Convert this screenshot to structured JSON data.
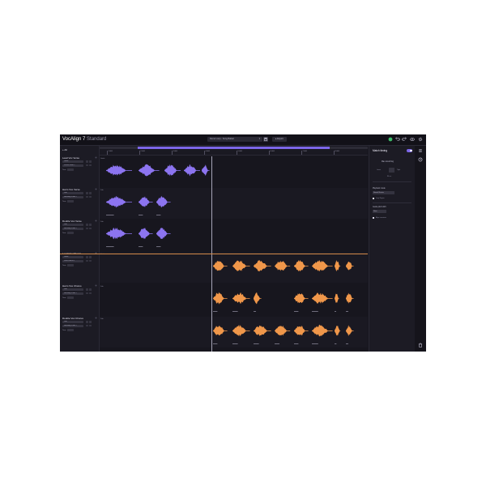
{
  "app": {
    "name": "VocAlign 7",
    "edition": "Standard"
  },
  "titlebar": {
    "session_name": "Demo Loop - Song Ballad",
    "export_label": "▸ Export"
  },
  "tracks_header": {
    "add_label": "+ All"
  },
  "tracks": [
    {
      "name": "Lead Vox Verse",
      "role": "Guide",
      "preset": "Vocals Guide 1",
      "time_label": "Time",
      "color": "#8c74f0"
    },
    {
      "name": "Harm Vox Verse",
      "role": "Dub",
      "preset": "Harmony Guide 1",
      "time_label": "Time",
      "color": "#8c74f0"
    },
    {
      "name": "Double Vox Verse",
      "role": "Dub",
      "preset": "Harmony Guide 1",
      "time_label": "Time",
      "color": "#8c74f0"
    },
    {
      "name": "Lead Vox Chorus",
      "role": "Guide",
      "preset": "Lead Chorus 1",
      "time_label": "Time",
      "color": "#f0974a"
    },
    {
      "name": "Harm Vox Chorus",
      "role": "Dub",
      "preset": "Harmony Guide 1",
      "time_label": "Time",
      "color": "#f0974a"
    },
    {
      "name": "Double Vox Chorus",
      "role": "Dub",
      "preset": "Harmony Guide 1",
      "time_label": "Time",
      "color": "#f0974a"
    }
  ],
  "ruler": {
    "ticks": [
      "1.000",
      "2.000",
      "3.000",
      "4.000",
      "5.000",
      "6.000",
      "7.000",
      "8.000"
    ]
  },
  "lanes": {
    "guide_label": "Guide",
    "dub_label": "Dub"
  },
  "right_panel": {
    "title": "Match timing",
    "toggle_on": true,
    "tightness_label": "Max stretching",
    "loose_label": "Loose",
    "tight_label": "Tight",
    "value_label": "80 ms",
    "algorithm_label": "Playback mode",
    "algorithm_value": "Normal Monitor",
    "preview_label": "Loop Region",
    "maxlimit_label": "Guide pitch shift",
    "maxlimit_value": "None",
    "transients_label": "Align transients"
  },
  "colors": {
    "accent": "#7c66e8",
    "verse": "#8c74f0",
    "chorus": "#f0974a",
    "background": "#17161e"
  },
  "icons": {
    "save": "save-icon",
    "status": "status-ok-icon",
    "undo": "undo-icon",
    "redo": "redo-icon",
    "eye": "eye-icon",
    "settings": "gear-icon",
    "menu": "menu-icon",
    "help": "help-icon",
    "trash": "trash-icon"
  }
}
